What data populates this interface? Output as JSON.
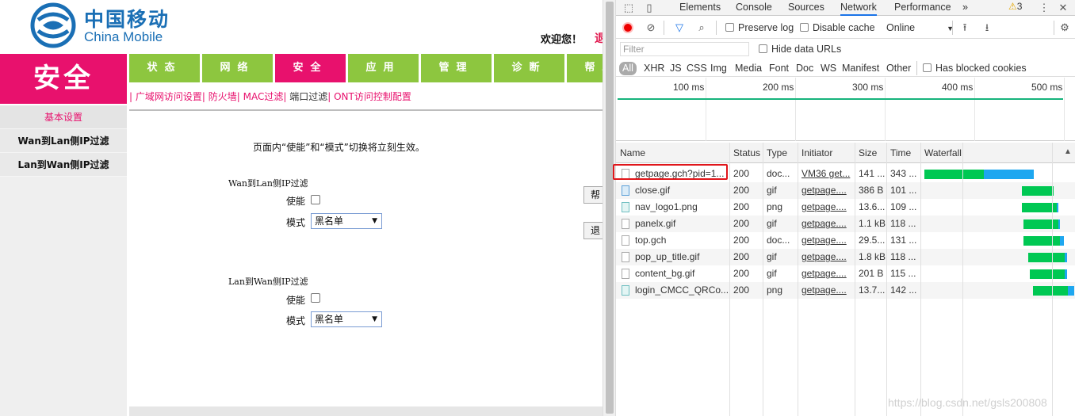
{
  "router": {
    "logo_cn": "中国移动",
    "logo_en": "China Mobile",
    "welcome": "欢迎您！",
    "logout_peek": "退",
    "section": "安全",
    "top_tabs": [
      "状态",
      "网络",
      "安全",
      "应用",
      "管理",
      "诊断",
      "帮助"
    ],
    "active_tab": "安全",
    "subnav": [
      "广域网访问设置",
      "防火墙",
      "MAC过滤",
      "端口过滤",
      "ONT访问控制配置"
    ],
    "subnav_current": "端口过滤",
    "sidebar": [
      "基本设置",
      "Wan到Lan侧IP过滤",
      "Lan到Wan侧IP过滤"
    ],
    "notice": "页面内“使能”和“模式”切换将立刻生效。",
    "groups": [
      {
        "title": "Wan到Lan侧IP过滤",
        "enable_label": "使能",
        "mode_label": "模式",
        "mode_value": "黑名单"
      },
      {
        "title": "Lan到Wan侧IP过滤",
        "enable_label": "使能",
        "mode_label": "模式",
        "mode_value": "黑名单"
      }
    ],
    "help_btn": "帮助",
    "exit_btn": "退出"
  },
  "devtools": {
    "tabs": [
      "Elements",
      "Console",
      "Sources",
      "Network",
      "Performance"
    ],
    "active_tab": "Network",
    "more": "»",
    "warnings": "3",
    "preserve_log": "Preserve log",
    "disable_cache": "Disable cache",
    "throttle": "Online",
    "filter_placeholder": "Filter",
    "hide_data_urls": "Hide data URLs",
    "types": [
      "All",
      "XHR",
      "JS",
      "CSS",
      "Img",
      "Media",
      "Font",
      "Doc",
      "WS",
      "Manifest",
      "Other"
    ],
    "has_blocked_cookies": "Has blocked cookies",
    "timeline_labels": [
      "100 ms",
      "200 ms",
      "300 ms",
      "400 ms",
      "500 ms"
    ],
    "columns": [
      "Name",
      "Status",
      "Type",
      "Initiator",
      "Size",
      "Time",
      "Waterfall"
    ],
    "rows": [
      {
        "name": "getpage.gch?pid=1...",
        "status": "200",
        "type": "doc...",
        "initiator": "VM36 get...",
        "size": "141 ...",
        "time": "343 ...",
        "icon": "doc"
      },
      {
        "name": "close.gif",
        "status": "200",
        "type": "gif",
        "initiator": "getpage....",
        "size": "386 B",
        "time": "101 ...",
        "icon": "img"
      },
      {
        "name": "nav_logo1.png",
        "status": "200",
        "type": "png",
        "initiator": "getpage....",
        "size": "13.6...",
        "time": "109 ...",
        "icon": "png"
      },
      {
        "name": "panelx.gif",
        "status": "200",
        "type": "gif",
        "initiator": "getpage....",
        "size": "1.1 kB",
        "time": "118 ...",
        "icon": "doc"
      },
      {
        "name": "top.gch",
        "status": "200",
        "type": "doc...",
        "initiator": "getpage....",
        "size": "29.5...",
        "time": "131 ...",
        "icon": "doc"
      },
      {
        "name": "pop_up_title.gif",
        "status": "200",
        "type": "gif",
        "initiator": "getpage....",
        "size": "1.8 kB",
        "time": "118 ...",
        "icon": "doc"
      },
      {
        "name": "content_bg.gif",
        "status": "200",
        "type": "gif",
        "initiator": "getpage....",
        "size": "201 B",
        "time": "115 ...",
        "icon": "doc"
      },
      {
        "name": "login_CMCC_QRCo...",
        "status": "200",
        "type": "png",
        "initiator": "getpage....",
        "size": "13.7...",
        "time": "142 ...",
        "icon": "png"
      }
    ],
    "watermark": "https://blog.csdn.net/gsls200808"
  }
}
